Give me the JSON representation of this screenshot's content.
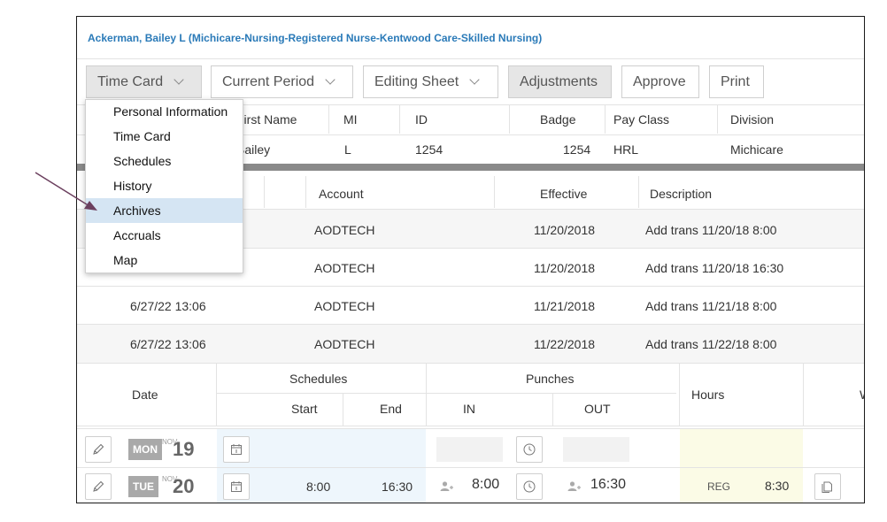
{
  "header": {
    "title": "Ackerman, Bailey L (Michicare-Nursing-Registered Nurse-Kentwood Care-Skilled Nursing)"
  },
  "toolbar": {
    "time_card": "Time Card",
    "current_period": "Current Period",
    "editing_sheet": "Editing Sheet",
    "adjustments": "Adjustments",
    "approve": "Approve",
    "print": "Print"
  },
  "dropdown": {
    "items": [
      "Personal Information",
      "Time Card",
      "Schedules",
      "History",
      "Archives",
      "Accruals",
      "Map"
    ],
    "highlighted": "Archives"
  },
  "employee_table": {
    "headers": {
      "first_name": "First Name",
      "mi": "MI",
      "id": "ID",
      "badge": "Badge",
      "pay_class": "Pay Class",
      "division": "Division"
    },
    "row": {
      "first_name": "Bailey",
      "mi": "L",
      "id": "1254",
      "badge": "1254",
      "pay_class": "HRL",
      "division": "Michicare"
    }
  },
  "archive_table": {
    "headers": {
      "account": "Account",
      "effective": "Effective",
      "description": "Description"
    },
    "rows": [
      {
        "timestamp": "",
        "account": "AODTECH",
        "effective": "11/20/2018",
        "description": "Add trans 11/20/18 8:00"
      },
      {
        "timestamp": "",
        "account": "AODTECH",
        "effective": "11/20/2018",
        "description": "Add trans 11/20/18 16:30"
      },
      {
        "timestamp": "6/27/22 13:06",
        "account": "AODTECH",
        "effective": "11/21/2018",
        "description": "Add trans 11/21/18 8:00"
      },
      {
        "timestamp": "6/27/22 13:06",
        "account": "AODTECH",
        "effective": "11/22/2018",
        "description": "Add trans 11/22/18 8:00"
      }
    ]
  },
  "timecard": {
    "headers": {
      "date": "Date",
      "schedules": "Schedules",
      "start": "Start",
      "end": "End",
      "punches": "Punches",
      "in": "IN",
      "out": "OUT",
      "hours": "Hours",
      "extra": "W"
    },
    "rows": [
      {
        "day": "MON",
        "month": "NOV",
        "date": "19",
        "start": "",
        "end": "",
        "in": "",
        "out": "",
        "pay_code": "",
        "hours": ""
      },
      {
        "day": "TUE",
        "month": "NOV",
        "date": "20",
        "start": "8:00",
        "end": "16:30",
        "in": "8:00",
        "out": "16:30",
        "pay_code": "REG",
        "hours": "8:30"
      }
    ]
  },
  "colors": {
    "title_blue": "#2a7ab8",
    "highlight": "#d5e5f3",
    "schedule_bg": "#eef6fc",
    "hours_bg": "#fbfbe6",
    "arrow": "#6b3f5e"
  },
  "icons": [
    "chevron-down-icon",
    "pencil-icon",
    "calendar-icon",
    "clock-icon",
    "add-person-icon",
    "copy-icon"
  ]
}
